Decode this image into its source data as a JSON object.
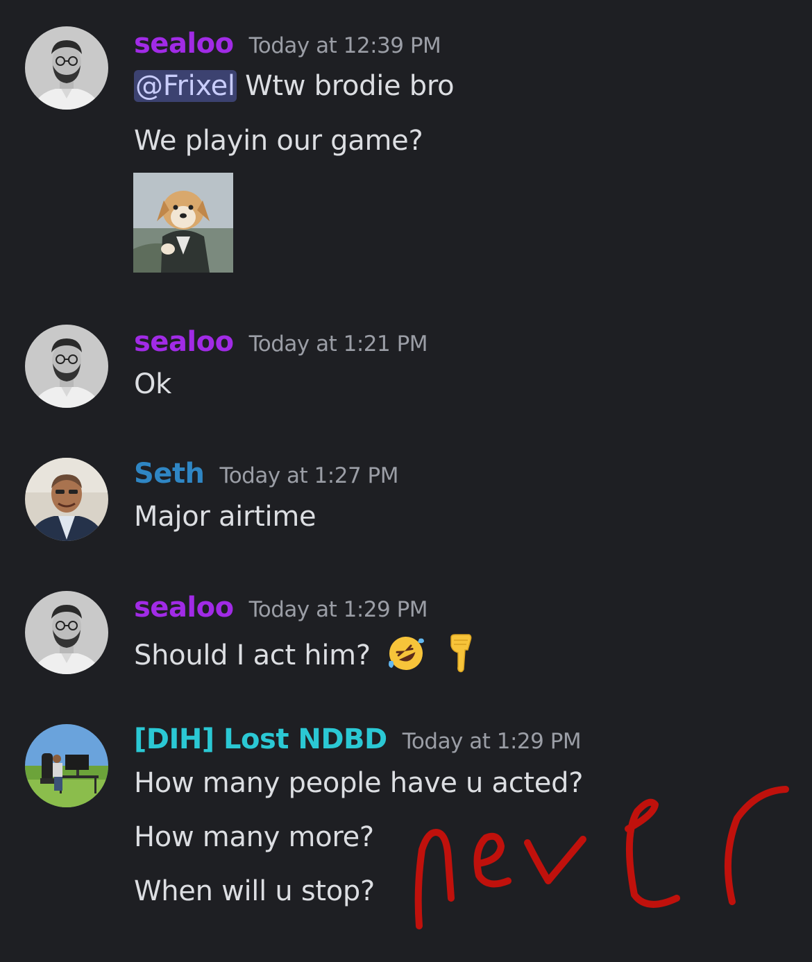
{
  "colors": {
    "background": "#1e1f23",
    "sealoo_name": "#a12be6",
    "seth_name": "#2f86c4",
    "lost_name": "#2bc8d4",
    "mention_bg": "#3c4270",
    "mention_text": "#c9cdfb",
    "timestamp": "#9b9ea6",
    "scribble": "#c0110c"
  },
  "messages": [
    {
      "author": "sealoo",
      "timestamp": "Today at 12:39 PM",
      "avatar_icon": "bearded-man-glasses-avatar",
      "lines": [
        {
          "mention": "@Frixel",
          "text": " Wtw brodie bro"
        },
        {
          "text": "We playin our game?"
        }
      ],
      "sticker": "puppy-in-suit-sticker"
    },
    {
      "author": "sealoo",
      "timestamp": "Today at 1:21 PM",
      "avatar_icon": "bearded-man-glasses-avatar",
      "lines": [
        {
          "text": "Ok"
        }
      ]
    },
    {
      "author": "Seth",
      "timestamp": "Today at 1:27 PM",
      "avatar_icon": "man-in-suit-avatar",
      "lines": [
        {
          "text": "Major airtime"
        }
      ]
    },
    {
      "author": "sealoo",
      "timestamp": "Today at 1:29 PM",
      "avatar_icon": "bearded-man-glasses-avatar",
      "lines": [
        {
          "text": "Should I act him? ",
          "emojis": [
            "rolling-on-floor-laughing-emoji",
            "backhand-index-pointing-down-emoji"
          ]
        }
      ]
    },
    {
      "author": "[DIH] Lost NDBD",
      "timestamp": "Today at 1:29 PM",
      "avatar_icon": "gaming-setup-outdoors-avatar",
      "lines": [
        {
          "text": "How many people have u acted?"
        },
        {
          "text": "How many more?"
        },
        {
          "text": "When will u stop?"
        }
      ]
    }
  ],
  "handwritten_annotation": "never"
}
